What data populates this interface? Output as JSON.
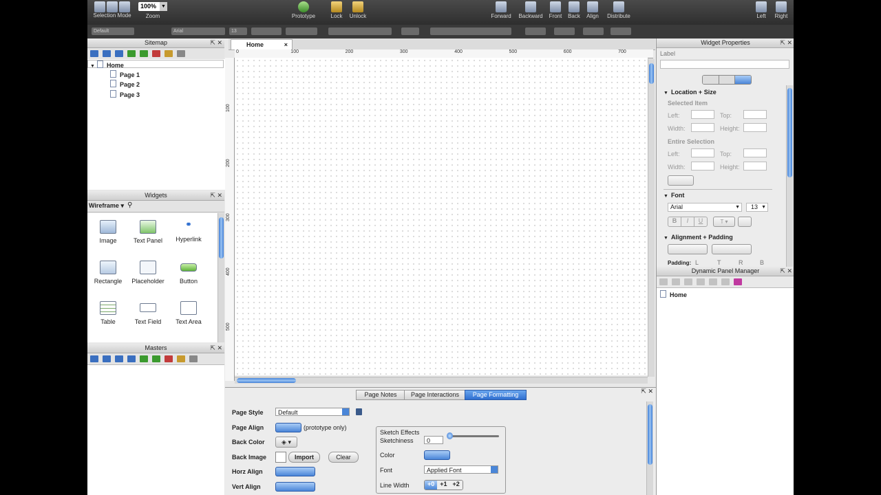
{
  "toolbar": {
    "selection_mode_label": "Selection Mode",
    "zoom_value": "100%",
    "zoom_label": "Zoom",
    "prototype_label": "Prototype",
    "lock_label": "Lock",
    "unlock_label": "Unlock",
    "forward_label": "Forward",
    "backward_label": "Backward",
    "front_label": "Front",
    "back_label": "Back",
    "align_label": "Align",
    "distribute_label": "Distribute",
    "left_label": "Left",
    "right_label": "Right"
  },
  "format_bar": {
    "style_value": "Default",
    "font_value": "Arial",
    "size_value": "13"
  },
  "sitemap": {
    "title": "Sitemap",
    "root": "Home",
    "pages": [
      "Page 1",
      "Page 2",
      "Page 3"
    ]
  },
  "widgets": {
    "title": "Widgets",
    "library": "Wireframe",
    "items": [
      "Image",
      "Text Panel",
      "Hyperlink",
      "Rectangle",
      "Placeholder",
      "Button",
      "Table",
      "Text Field",
      "Text Area"
    ]
  },
  "masters": {
    "title": "Masters"
  },
  "canvas": {
    "tab_label": "Home",
    "tab_close": "×",
    "ruler_h": [
      "0",
      "100",
      "200",
      "300",
      "400",
      "500",
      "600",
      "700"
    ],
    "ruler_v": [
      "100",
      "200",
      "300",
      "400",
      "500"
    ]
  },
  "bottom_panel": {
    "tabs": [
      "Page Notes",
      "Page Interactions",
      "Page Formatting"
    ],
    "active_tab": "Page Formatting",
    "page_style_label": "Page Style",
    "page_style_value": "Default",
    "page_align_label": "Page Align",
    "page_align_note": "(prototype only)",
    "back_color_label": "Back Color",
    "back_image_label": "Back Image",
    "import_label": "Import",
    "clear_label": "Clear",
    "horz_align_label": "Horz Align",
    "vert_align_label": "Vert Align",
    "sketch_effects_label": "Sketch Effects",
    "sketchiness_label": "Sketchiness",
    "sketchiness_value": "0",
    "color_label": "Color",
    "font_label": "Font",
    "font_value": "Applied Font",
    "line_width_label": "Line Width",
    "line_width_options": [
      "+0",
      "+1",
      "+2"
    ]
  },
  "widget_properties": {
    "title": "Widget Properties",
    "label_caption": "Label",
    "location_size": "Location + Size",
    "selected_item": "Selected Item",
    "entire_selection": "Entire Selection",
    "left": "Left:",
    "top": "Top:",
    "width": "Width:",
    "height": "Height:",
    "font_section": "Font",
    "font_value": "Arial",
    "font_size": "13",
    "bold": "B",
    "italic": "I",
    "underline": "U",
    "text_color": "T",
    "alignment_section": "Alignment + Padding",
    "padding_label": "Padding:",
    "padding_l": "L",
    "padding_t": "T",
    "padding_r": "R",
    "padding_b": "B"
  },
  "dynamic_panel_manager": {
    "title": "Dynamic Panel Manager",
    "item": "Home"
  }
}
